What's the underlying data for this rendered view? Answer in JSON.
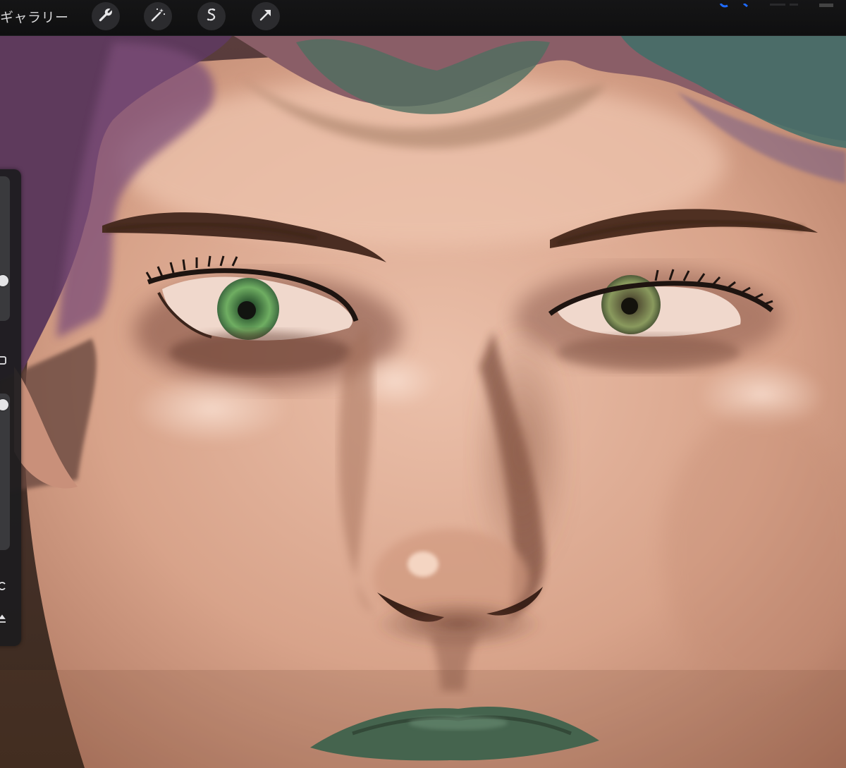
{
  "toolbar": {
    "gallery_label": "ギャラリー",
    "tools": [
      {
        "name": "wrench-icon",
        "label": "actions"
      },
      {
        "name": "magic-wand-icon",
        "label": "adjustments"
      },
      {
        "name": "selection-s-icon",
        "label": "selection"
      },
      {
        "name": "arrow-icon",
        "label": "transform"
      }
    ],
    "accent_color": "#1f6bff"
  },
  "sidebar": {
    "size_slider_level": 0.95,
    "opacity_slider_level": 0.92,
    "icons": [
      "modify-square-icon",
      "undo-icon",
      "redo-icon"
    ]
  },
  "canvas": {
    "artwork": "digital-portrait-painting",
    "palette": {
      "skin_light": "#e8b9a2",
      "skin_mid": "#c98a6e",
      "skin_shadow": "#7a4a39",
      "hair_purple": "#6b3a66",
      "hair_teal": "#3e7a72",
      "iris_green": "#5d9a5a",
      "lips_green": "#3f6a54",
      "brow_brown": "#4a2d22"
    }
  }
}
